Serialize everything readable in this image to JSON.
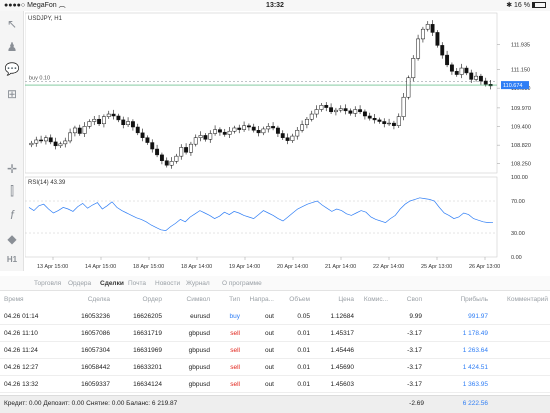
{
  "status_bar": {
    "carrier": "MegaFon",
    "time": "13:32",
    "battery": "16 %"
  },
  "chart": {
    "symbol_label": "USDJPY, H1",
    "order_label": "buy 0.10",
    "current_price": "110.674",
    "price_ticks": [
      "111.935",
      "111.150",
      "110.580",
      "109.970",
      "109.400",
      "108.820",
      "108.250"
    ],
    "indicator_label": "RSI(14) 43.39",
    "rsi_ticks": [
      "100.00",
      "70.00",
      "30.00",
      "0.00"
    ],
    "time_ticks": [
      "13 Apr 15:00",
      "14 Apr 15:00",
      "18 Apr 15:00",
      "18 Apr 14:00",
      "19 Apr 14:00",
      "20 Apr 14:00",
      "21 Apr 14:00",
      "22 Apr 14:00",
      "25 Apr 13:00",
      "26 Apr 13:00"
    ],
    "accent_color": "#2f7ef5"
  },
  "chart_data": {
    "type": "candlestick",
    "title": "USDJPY, H1",
    "closes": [
      108.88,
      108.98,
      108.95,
      109.05,
      108.92,
      108.8,
      108.86,
      108.95,
      109.2,
      109.35,
      109.18,
      109.4,
      109.55,
      109.62,
      109.48,
      109.7,
      109.78,
      109.72,
      109.6,
      109.45,
      109.55,
      109.38,
      109.2,
      109.05,
      108.9,
      108.7,
      108.52,
      108.34,
      108.2,
      108.32,
      108.48,
      108.75,
      108.6,
      108.85,
      109.05,
      109.12,
      109.0,
      109.18,
      109.3,
      109.22,
      109.15,
      109.25,
      109.35,
      109.3,
      109.42,
      109.38,
      109.28,
      109.2,
      109.32,
      109.4,
      109.35,
      109.18,
      109.05,
      108.96,
      109.1,
      109.28,
      109.45,
      109.62,
      109.78,
      109.92,
      110.05,
      109.98,
      109.85,
      109.9,
      109.95,
      109.88,
      109.8,
      109.92,
      109.85,
      109.72,
      109.65,
      109.6,
      109.55,
      109.48,
      109.5,
      109.42,
      109.7,
      110.3,
      110.9,
      111.5,
      112.1,
      112.4,
      112.55,
      112.3,
      111.9,
      111.6,
      111.3,
      111.1,
      111.0,
      111.2,
      111.05,
      110.85,
      110.95,
      110.8,
      110.7,
      110.65
    ],
    "price_range": [
      107.96,
      112.9
    ],
    "rsi": [
      62,
      58,
      64,
      66,
      60,
      55,
      58,
      62,
      60,
      57,
      63,
      67,
      61,
      65,
      68,
      60,
      64,
      69,
      62,
      58,
      55,
      52,
      49,
      47,
      44,
      40,
      37,
      34,
      33,
      38,
      42,
      47,
      44,
      50,
      54,
      58,
      55,
      52,
      48,
      51,
      56,
      53,
      57,
      55,
      52,
      50,
      48,
      53,
      58,
      55,
      52,
      48,
      45,
      50,
      55,
      60,
      63,
      66,
      68,
      70,
      65,
      61,
      57,
      60,
      58,
      54,
      52,
      55,
      58,
      56,
      50,
      47,
      45,
      43,
      48,
      52,
      60,
      66,
      70,
      72,
      74,
      73,
      72,
      70,
      62,
      55,
      52,
      48,
      50,
      55,
      53,
      48,
      46,
      44,
      43,
      43.39
    ],
    "rsi_range": [
      0,
      100
    ],
    "rsi_levels": [
      30,
      70
    ],
    "current_price": 110.674,
    "order_level": 110.78
  },
  "tabs": [
    {
      "label": "Торговля",
      "active": false
    },
    {
      "label": "Ордера",
      "active": false
    },
    {
      "label": "Сделки",
      "active": true
    },
    {
      "label": "Почта",
      "active": false
    },
    {
      "label": "Новости",
      "active": false
    },
    {
      "label": "Журнал",
      "active": false
    },
    {
      "label": "О программе",
      "active": false
    }
  ],
  "table": {
    "headers": [
      "Время",
      "Сделка",
      "Ордер",
      "Символ",
      "Тип",
      "Напра...",
      "Объем",
      "Цена",
      "Комис...",
      "Своп",
      "Прибыль",
      "Комментарий"
    ],
    "rows": [
      {
        "time": "04.26 01:14",
        "deal": "16053236",
        "order": "16626205",
        "symbol": "eurusd",
        "type": "buy",
        "dir": "out",
        "volume": "0.05",
        "price": "1.12684",
        "commission": "",
        "swap": "9.99",
        "profit": "991.97",
        "comment": ""
      },
      {
        "time": "04.26 11:10",
        "deal": "16057086",
        "order": "16631719",
        "symbol": "gbpusd",
        "type": "sell",
        "dir": "out",
        "volume": "0.01",
        "price": "1.45317",
        "commission": "",
        "swap": "-3.17",
        "profit": "1 178.49",
        "comment": ""
      },
      {
        "time": "04.26 11:24",
        "deal": "16057304",
        "order": "16631969",
        "symbol": "gbpusd",
        "type": "sell",
        "dir": "out",
        "volume": "0.01",
        "price": "1.45446",
        "commission": "",
        "swap": "-3.17",
        "profit": "1 263.64",
        "comment": ""
      },
      {
        "time": "04.26 12:27",
        "deal": "16058442",
        "order": "16633201",
        "symbol": "gbpusd",
        "type": "sell",
        "dir": "out",
        "volume": "0.01",
        "price": "1.45690",
        "commission": "",
        "swap": "-3.17",
        "profit": "1 424.51",
        "comment": ""
      },
      {
        "time": "04.26 13:32",
        "deal": "16059337",
        "order": "16634124",
        "symbol": "gbpusd",
        "type": "sell",
        "dir": "out",
        "volume": "0.01",
        "price": "1.45603",
        "commission": "",
        "swap": "-3.17",
        "profit": "1 363.95",
        "comment": ""
      }
    ]
  },
  "footer": {
    "summary": "Кредит: 0.00 Депозит: 0.00 Снятие: 0.00 Баланс: 6 219.87",
    "swap_total": "-2.69",
    "profit_total": "6 222.56"
  },
  "toolbar": {
    "timeframe": "H1"
  }
}
